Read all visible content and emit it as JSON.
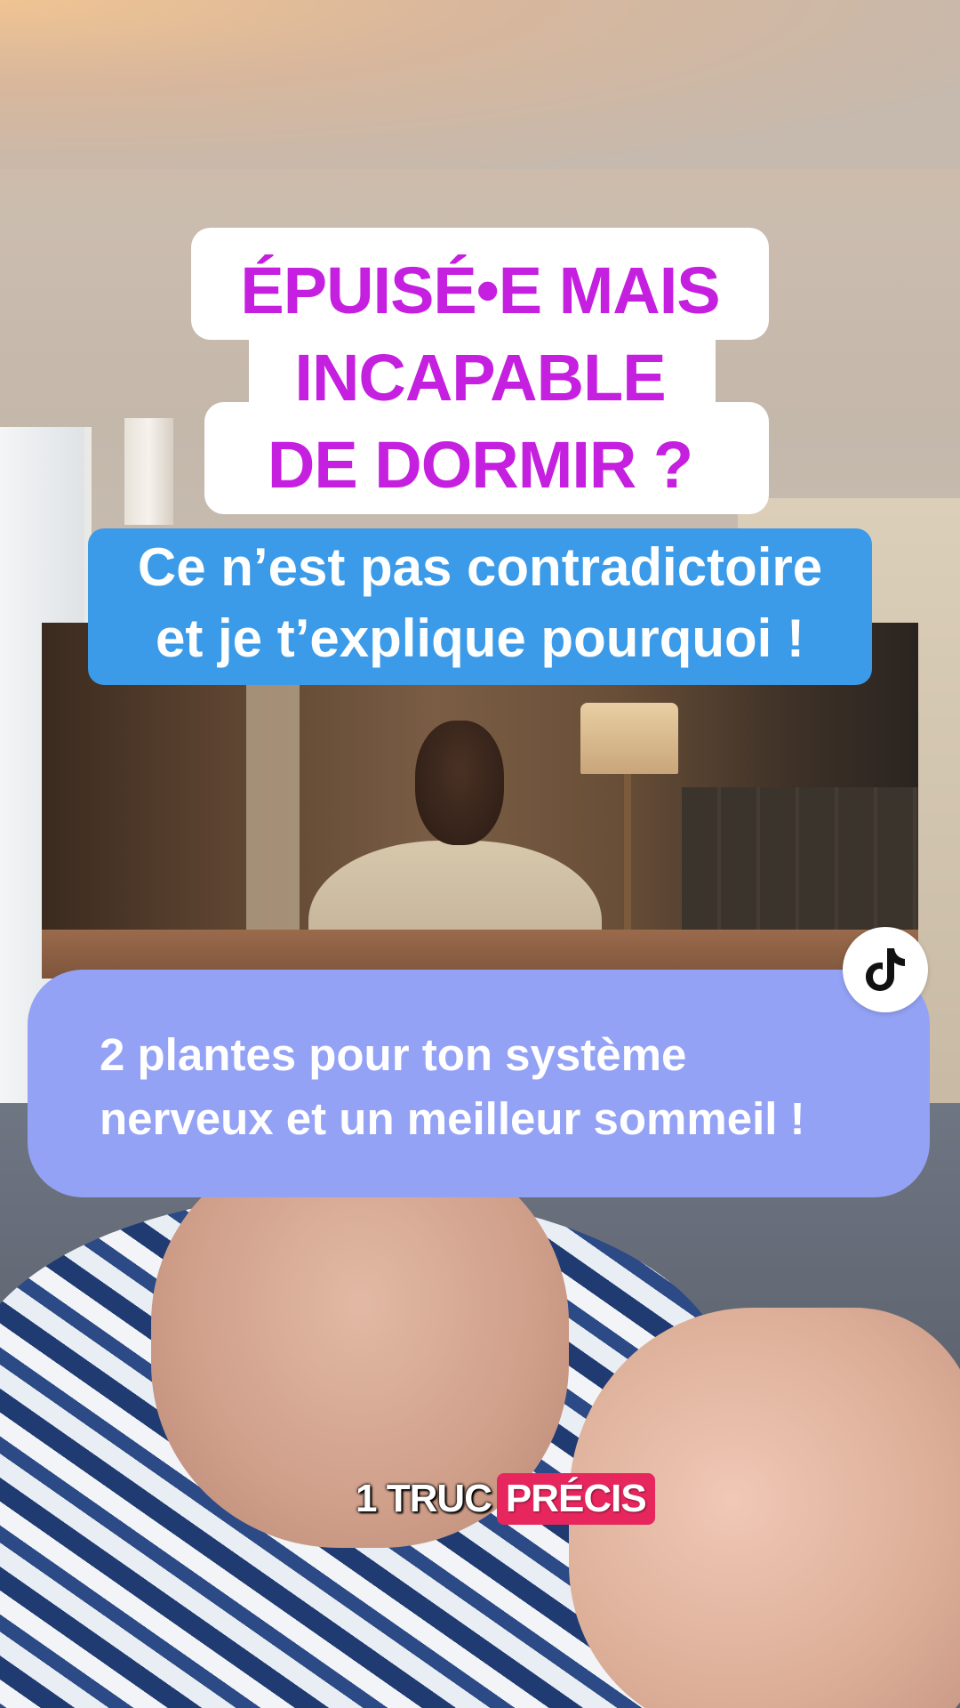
{
  "overlay": {
    "title_lines": [
      "ÉPUISÉ•E MAIS",
      "INCAPABLE",
      "DE DORMIR ?"
    ],
    "subtitle_lines": [
      "Ce n’est pas contradictoire",
      "et je t’explique pourquoi !"
    ],
    "card_lines": [
      "2 plantes pour ton système",
      "nerveux et un meilleur sommeil !"
    ],
    "caption_plain": "1 TRUC",
    "caption_highlight": "PRÉCIS"
  },
  "badge": {
    "icon": "tiktok-logo-icon"
  },
  "colors": {
    "title": "#c51fe0",
    "subtitle_bg": "#3b9be8",
    "card_bg": "#94a2f5",
    "caption_highlight_bg": "#e8265e"
  }
}
